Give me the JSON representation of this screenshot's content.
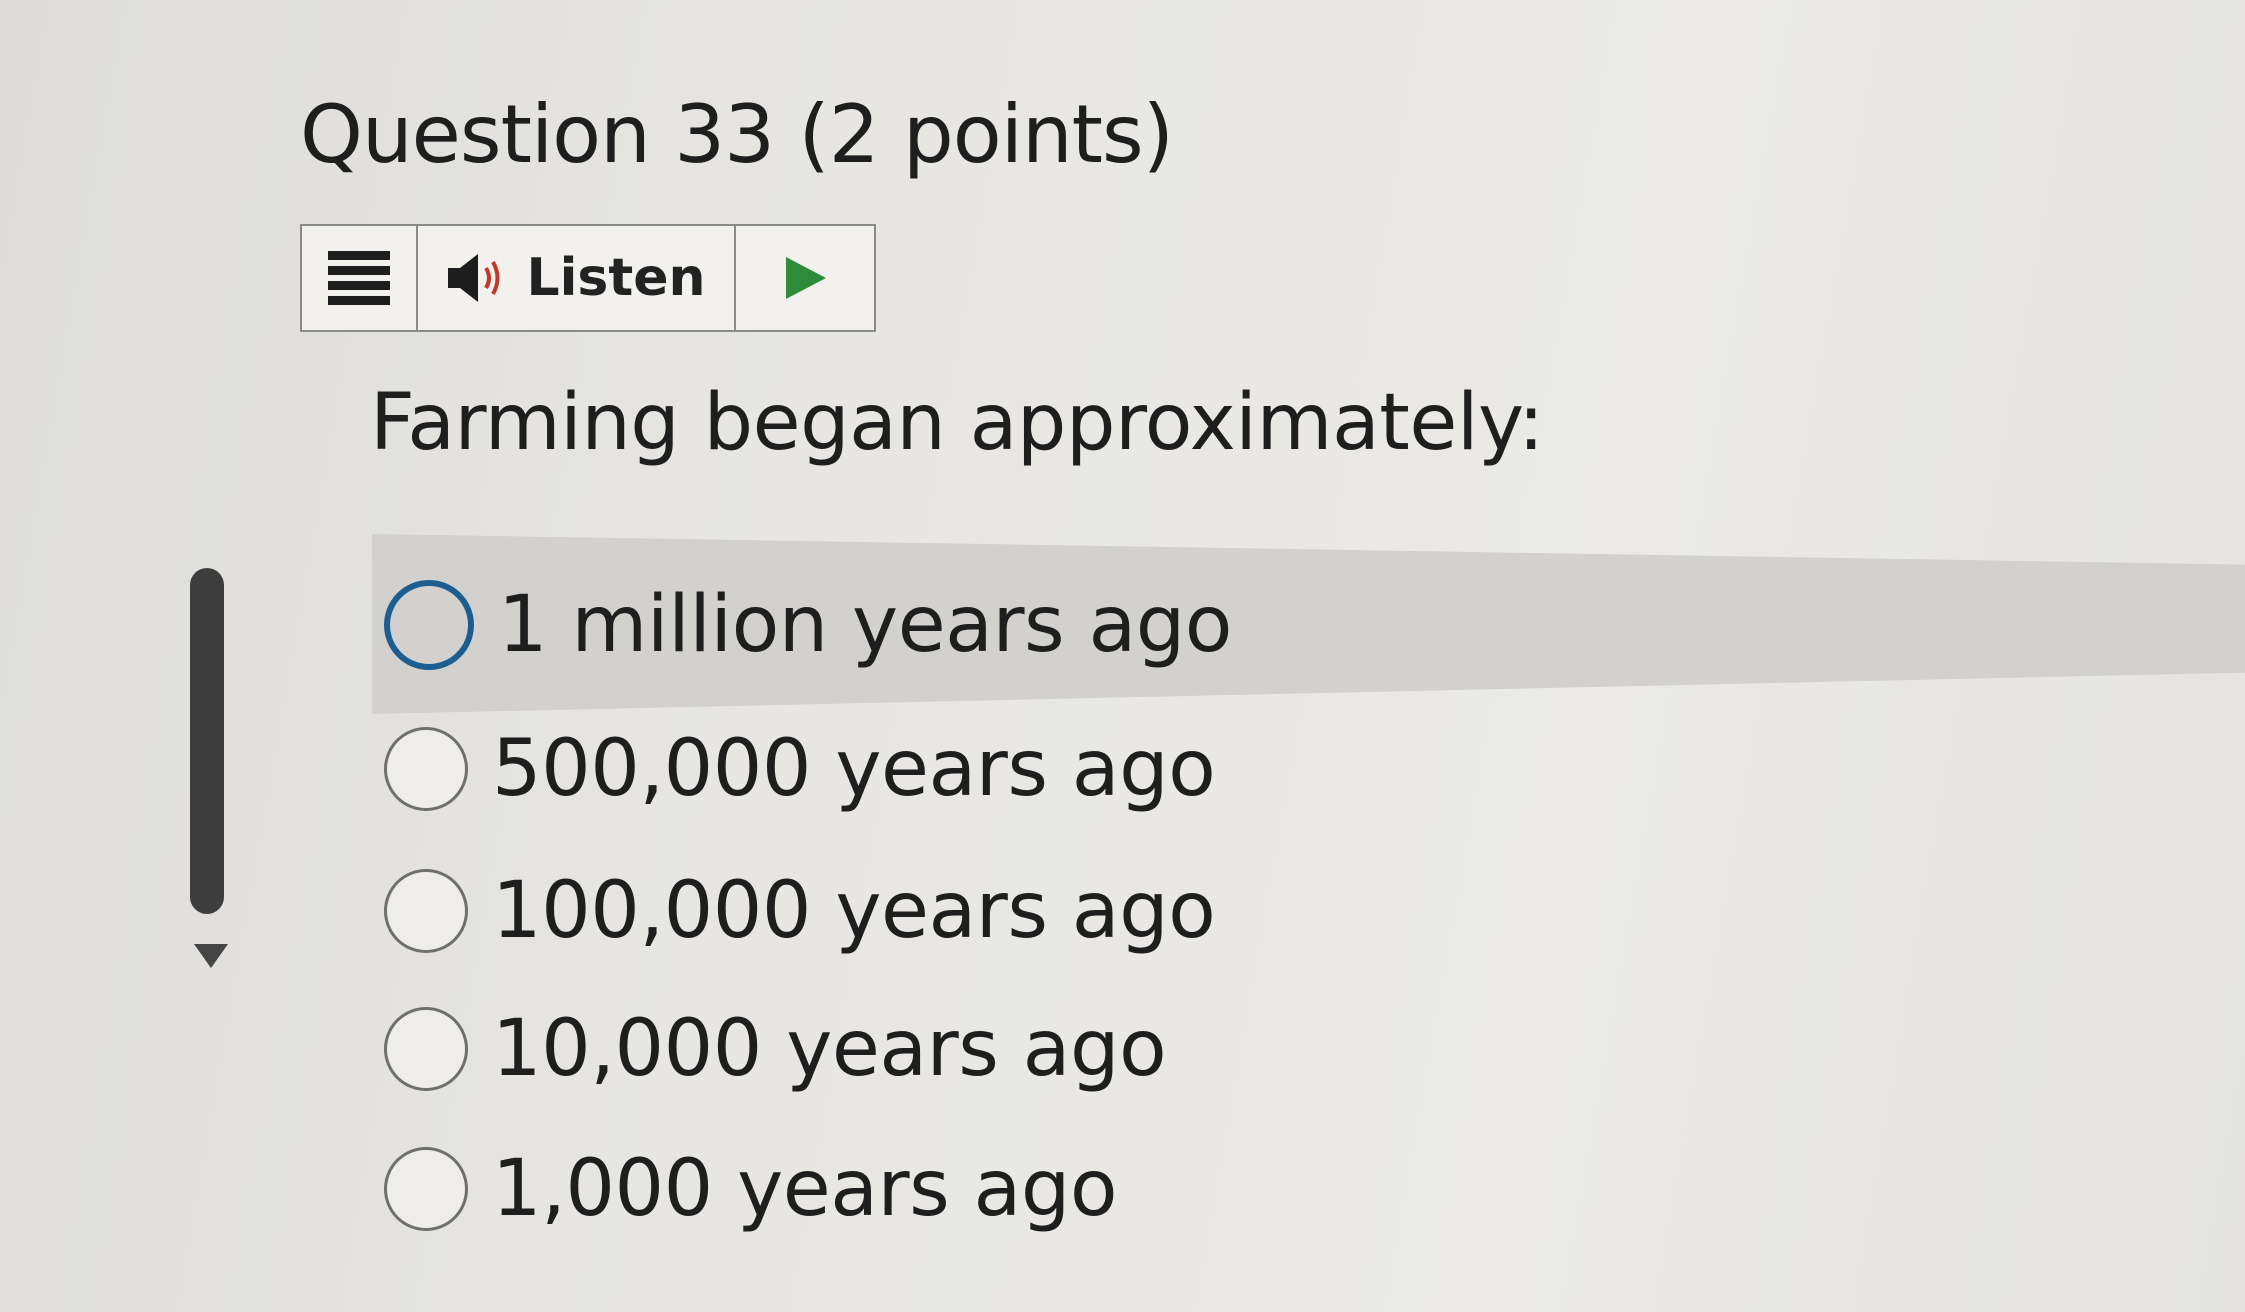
{
  "question": {
    "title": "Question 33",
    "points": "(2 points)",
    "prompt": "Farming began approximately:"
  },
  "readspeaker": {
    "menu_icon": "hamburger-menu-icon",
    "speaker_icon": "speaker-icon",
    "listen_label": "Listen",
    "play_icon": "play-icon"
  },
  "options": [
    {
      "label": "1 million years ago",
      "focused": true,
      "selected": false
    },
    {
      "label": "500,000 years ago",
      "focused": false,
      "selected": false
    },
    {
      "label": "100,000 years ago",
      "focused": false,
      "selected": false
    },
    {
      "label": "10,000 years ago",
      "focused": false,
      "selected": false
    },
    {
      "label": "1,000 years ago",
      "focused": false,
      "selected": false
    }
  ],
  "colors": {
    "focus_ring": "#1b5e8f",
    "play_green": "#2e8b3a"
  }
}
